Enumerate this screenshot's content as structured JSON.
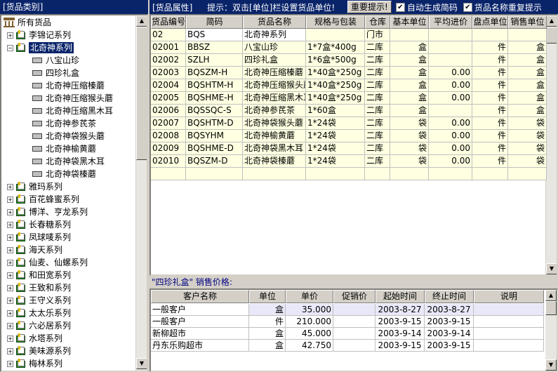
{
  "left_header": {
    "title": "[货品类别]"
  },
  "right_header": {
    "label": "[货品属性]",
    "hint": "提示：双击[单位]栏设置货品单位!",
    "important_button": "重要提示!",
    "auto_code_label": "自动生成简码",
    "auto_code_checked": true,
    "dup_name_label": "货品名称重复提示",
    "dup_name_checked": true
  },
  "tree": {
    "root": "所有货品",
    "before": [
      "李锦记系列"
    ],
    "expanded": "北奇神系列",
    "children": [
      "八宝山珍",
      "四珍礼盒",
      "北奇神压缩榛蘑",
      "北奇神压缩猴头蘑",
      "北奇神压缩黑木耳",
      "北奇神参芪茶",
      "北奇神袋猴头蘑",
      "北奇神榆黄蘑",
      "北奇神袋黑木耳",
      "北奇神袋榛蘑"
    ],
    "after": [
      "雅玛系列",
      "百花蜂蜜系列",
      "博洋、亨龙系列",
      "长春糖系列",
      "凤球唛系列",
      "海天系列",
      "仙麦、仙螺系列",
      "和田宽系列",
      "王致和系列",
      "王守义系列",
      "太太乐系列",
      "六必居系列",
      "水塔系列",
      "美味源系列",
      "梅林系列"
    ]
  },
  "grid": {
    "columns": [
      "货品编号",
      "简码",
      "货品名称",
      "规格与包装",
      "仓库",
      "基本单位",
      "平均进价",
      "盘点单位",
      "销售单位"
    ],
    "rows": [
      [
        "02",
        "BQS",
        "北奇神系列",
        "",
        "门市",
        "",
        "",
        "",
        ""
      ],
      [
        "02001",
        "BBSZ",
        "八宝山珍",
        "1*7盒*400g",
        "二库",
        "盒",
        "",
        "件",
        "盒"
      ],
      [
        "02002",
        "SZLH",
        "四珍礼盒",
        "1*6盒*500g",
        "二库",
        "盒",
        "",
        "件",
        "盒"
      ],
      [
        "02003",
        "BQSZM-H",
        "北奇神压缩榛蘑",
        "1*40盒*250g",
        "二库",
        "盒",
        "0.00",
        "件",
        "盒"
      ],
      [
        "02004",
        "BQSHTM-H",
        "北奇神压缩猴头蘑",
        "1*40盒*250g",
        "二库",
        "盒",
        "0.00",
        "件",
        "盒"
      ],
      [
        "02005",
        "BQSHME-H",
        "北奇神压缩黑木耳",
        "1*40盒*250g",
        "二库",
        "盒",
        "0.00",
        "件",
        "盒"
      ],
      [
        "02006",
        "BQSSQC-S",
        "北奇神参芪茶",
        "1*60盒",
        "二库",
        "盒",
        "",
        "件",
        "盒"
      ],
      [
        "02007",
        "BQSHTM-D",
        "北奇神袋猴头蘑",
        "1*24袋",
        "二库",
        "袋",
        "0.00",
        "件",
        "袋"
      ],
      [
        "02008",
        "BQSYHM",
        "北奇神榆黄蘑",
        "1*24袋",
        "二库",
        "袋",
        "0.00",
        "件",
        "袋"
      ],
      [
        "02009",
        "BQSHME-D",
        "北奇神袋黑木耳",
        "1*24袋",
        "二库",
        "袋",
        "0.00",
        "件",
        "袋"
      ],
      [
        "02010",
        "BQSZM-D",
        "北奇神袋榛蘑",
        "1*24袋",
        "二库",
        "袋",
        "0.00",
        "件",
        "袋"
      ]
    ]
  },
  "price": {
    "label": "\"四珍礼盒\" 销售价格:",
    "columns": [
      "客户名称",
      "单位",
      "单价",
      "促销价",
      "起始时间",
      "终止时间",
      "说明"
    ],
    "rows": [
      [
        "一般客户",
        "盒",
        "35.000",
        "",
        "2003-8-27",
        "2003-8-27",
        ""
      ],
      [
        "一般客户",
        "件",
        "210.000",
        "",
        "2003-9-15",
        "2003-9-15",
        ""
      ],
      [
        "新柳超市",
        "盒",
        "45.000",
        "",
        "2003-9-14",
        "2003-9-14",
        ""
      ],
      [
        "丹东乐购超市",
        "盒",
        "42.750",
        "",
        "2003-9-15",
        "2003-9-15",
        ""
      ]
    ]
  },
  "colors": {
    "title_bar": "#0a246a",
    "row_yellow": "#ffffe1",
    "row_blue": "#e8e8f8",
    "folder": "#2d8a2d"
  }
}
